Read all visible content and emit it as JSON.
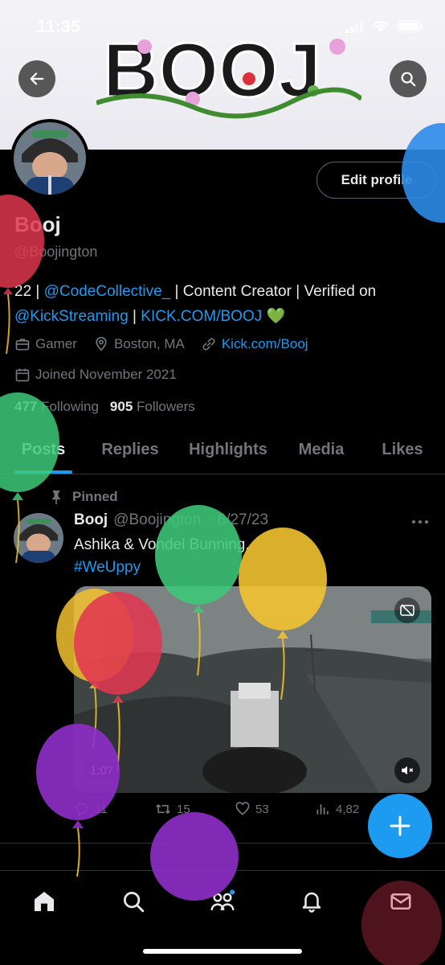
{
  "status_bar": {
    "time": "11:35"
  },
  "banner": {
    "logo_text": "BOOJ"
  },
  "profile": {
    "name": "Booj",
    "handle": "@Boojington",
    "edit_label": "Edit profile",
    "bio": {
      "prefix": "22 | ",
      "link1": "@CodeCollective_",
      "middle": " | Content Creator | Verified on ",
      "link2": "@KickStreaming",
      "sep": " | ",
      "link3": "KICK.COM/BOOJ",
      "emoji": " 💚"
    },
    "category": "Gamer",
    "location": "Boston, MA",
    "website": "Kick.com/Booj",
    "joined": "Joined November 2021",
    "following_count": "477",
    "following_label": "Following",
    "followers_count": "905",
    "followers_label": "Followers"
  },
  "tabs": [
    "Posts",
    "Replies",
    "Highlights",
    "Media",
    "Likes"
  ],
  "post": {
    "pinned_label": "Pinned",
    "author": "Booj",
    "handle": "@Boojington",
    "dot": "·",
    "date": "6/27/23",
    "text_line1": "Ashika & Vondel Bunning.",
    "hashtag": "#WeUppy",
    "media_time": "1:07",
    "replies": "11",
    "reposts": "15",
    "likes": "53",
    "views": "4,82"
  },
  "colors": {
    "accent": "#1d9bf0",
    "muted": "#71767b",
    "text": "#e7e9ea",
    "balloon_red": "#e0374f",
    "balloon_green": "#3ec97a",
    "balloon_yellow": "#f2c230",
    "balloon_purple": "#8e2fc9",
    "balloon_blue": "#2d8be8"
  },
  "icons": {
    "back": "arrow-left-icon",
    "search": "search-icon",
    "category": "briefcase-icon",
    "location": "location-pin-icon",
    "website": "link-icon",
    "joined": "calendar-icon",
    "pin": "pin-icon",
    "nav": [
      "home-icon",
      "search-icon",
      "communities-icon",
      "bell-icon",
      "mail-icon"
    ]
  }
}
